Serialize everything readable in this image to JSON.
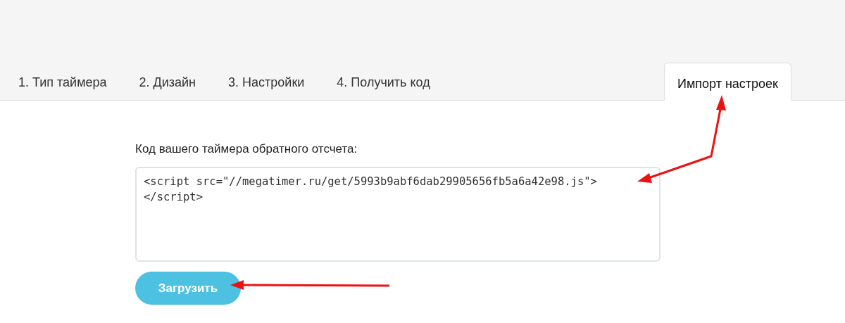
{
  "tabs": [
    {
      "label": "1. Тип таймера",
      "selected": false
    },
    {
      "label": "2. Дизайн",
      "selected": false
    },
    {
      "label": "3. Настройки",
      "selected": false
    },
    {
      "label": "4. Получить код",
      "selected": false
    },
    {
      "label": "Импорт настроек",
      "selected": true
    }
  ],
  "code_field": {
    "label": "Код вашего таймера обратного отсчета:",
    "value": "<script src=\"//megatimer.ru/get/5993b9abf6dab29905656fb5a6a42e98.js\">\n</script>"
  },
  "load_button": {
    "label": "Загрузить"
  }
}
